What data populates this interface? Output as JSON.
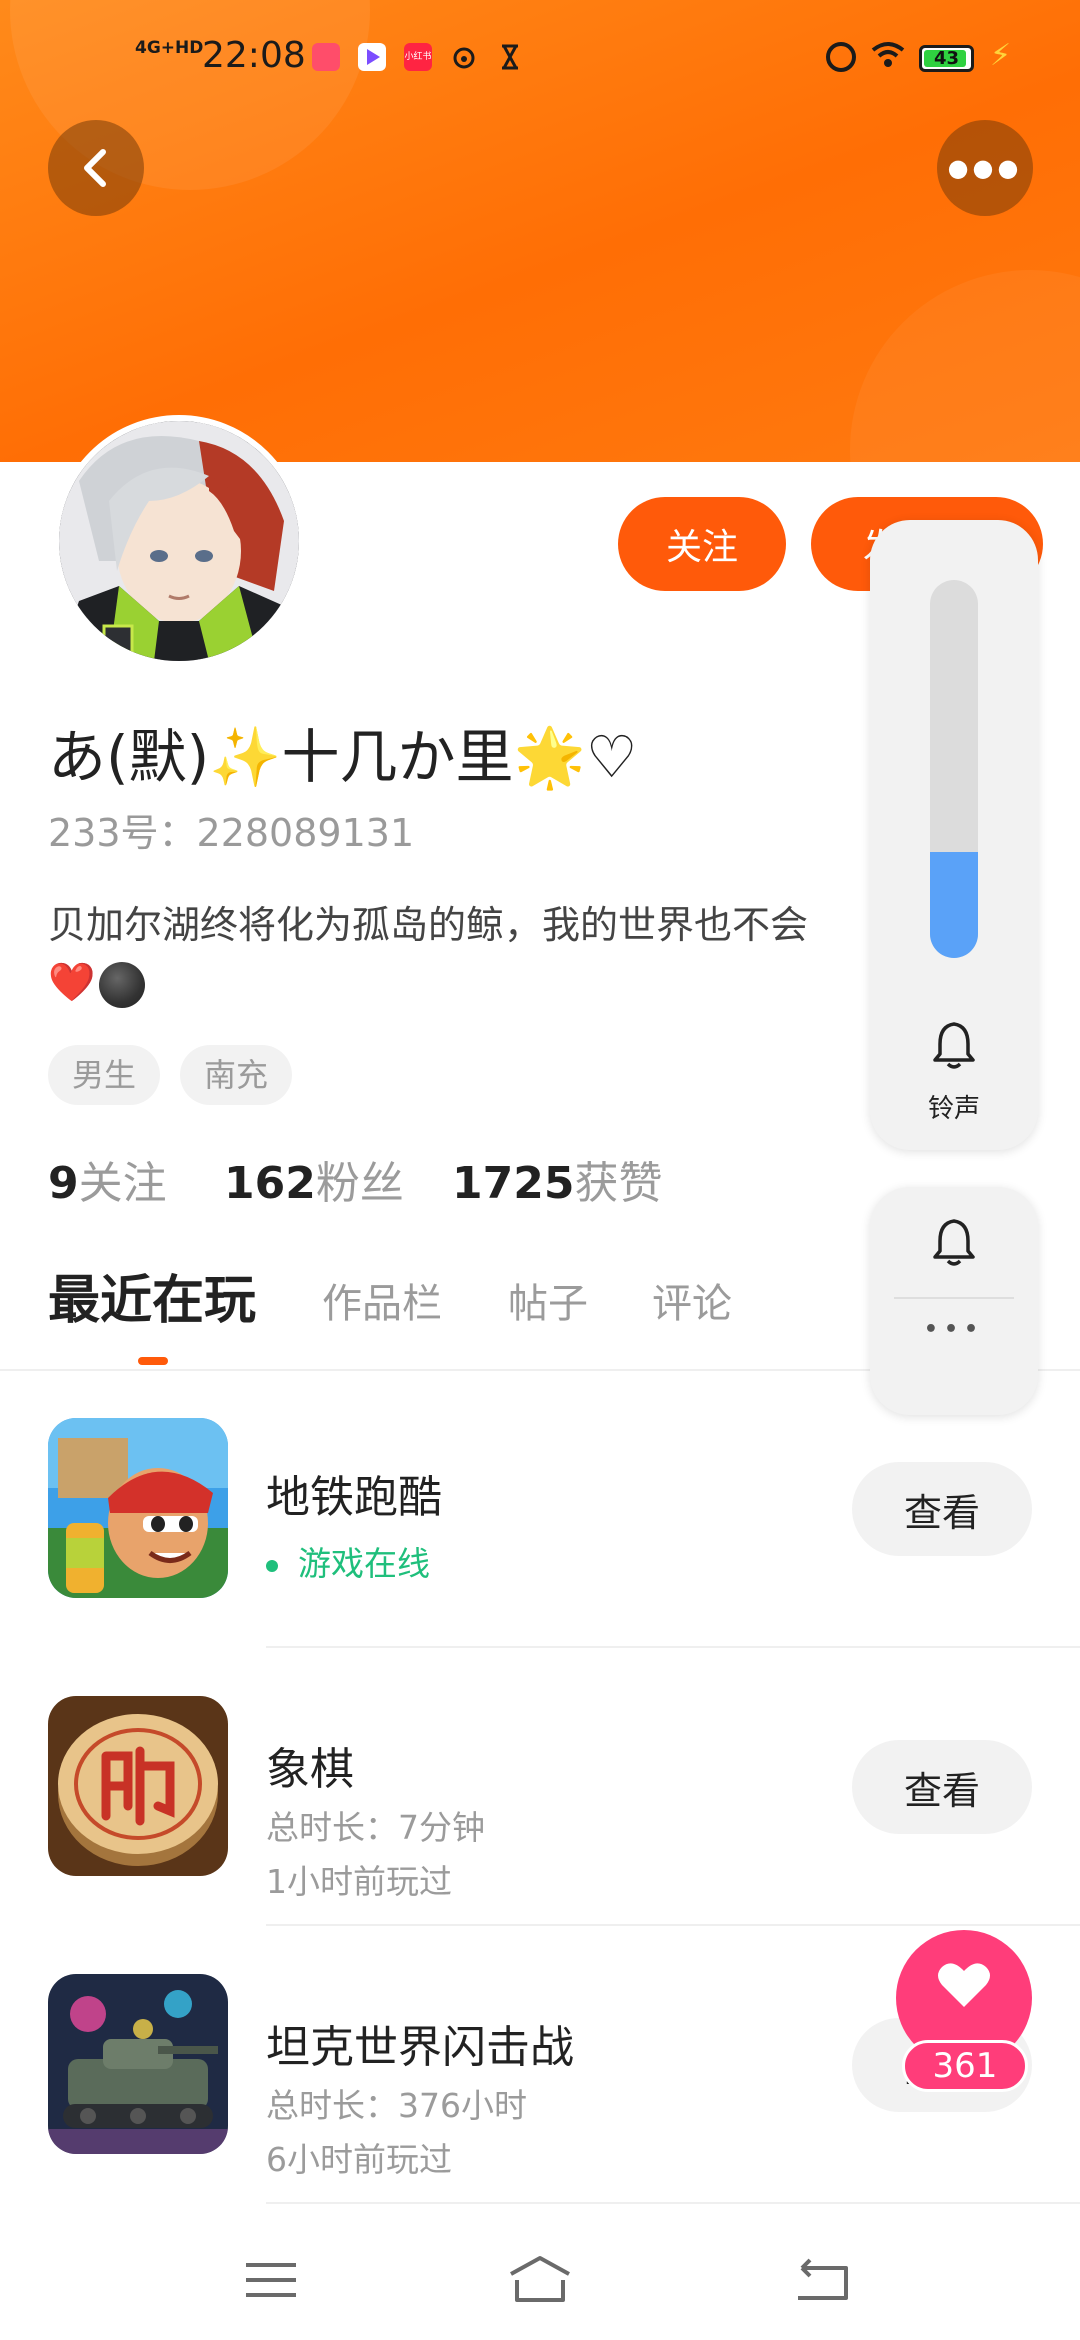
{
  "status_bar": {
    "network": "4G+HD",
    "time": "22:08",
    "battery": "43",
    "apps": [
      {
        "icon": "red-app-icon",
        "color": "#ff4d6a"
      },
      {
        "icon": "video-app-icon",
        "color": "#7b4dff"
      },
      {
        "icon": "xiaohongshu-icon",
        "color": "#ff2442",
        "text": "小红书"
      },
      {
        "icon": "weibo-icon",
        "color": "transparent"
      },
      {
        "icon": "hourglass-icon",
        "color": "transparent"
      }
    ]
  },
  "profile": {
    "nickname": "あ(默)✨十几か里🌟♡",
    "uid": "233号：228089131",
    "bio": "贝加尔湖终将化为孤岛的鲸，我的世界也不会",
    "bio_emoji": "❤️",
    "tags": [
      "男生",
      "南充"
    ]
  },
  "actions": {
    "follow": "关注",
    "chat": "发"
  },
  "stats": [
    {
      "num": "9",
      "label": "关注"
    },
    {
      "num": "162",
      "label": "粉丝"
    },
    {
      "num": "1725",
      "label": "获赞"
    }
  ],
  "tabs": [
    "最近在玩",
    "作品栏",
    "帖子",
    "评论"
  ],
  "games": [
    {
      "name": "地铁跑酷",
      "status": "游戏在线",
      "button": "查看"
    },
    {
      "name": "象棋",
      "duration": "总时长：7分钟",
      "last_played": "1小时前玩过",
      "button": "查看"
    },
    {
      "name": "坦克世界闪击战",
      "duration": "总时长：376小时",
      "last_played": "6小时前玩过",
      "button": "查看"
    }
  ],
  "volume_overlay": {
    "label": "铃声",
    "level": 0.28
  },
  "like": {
    "count": "361",
    "color": "#ff3d7a"
  },
  "colors": {
    "accent": "#ff5a0a",
    "header": "#ff7a10",
    "online": "#1fbf7c",
    "volume": "#5aa2f8"
  }
}
